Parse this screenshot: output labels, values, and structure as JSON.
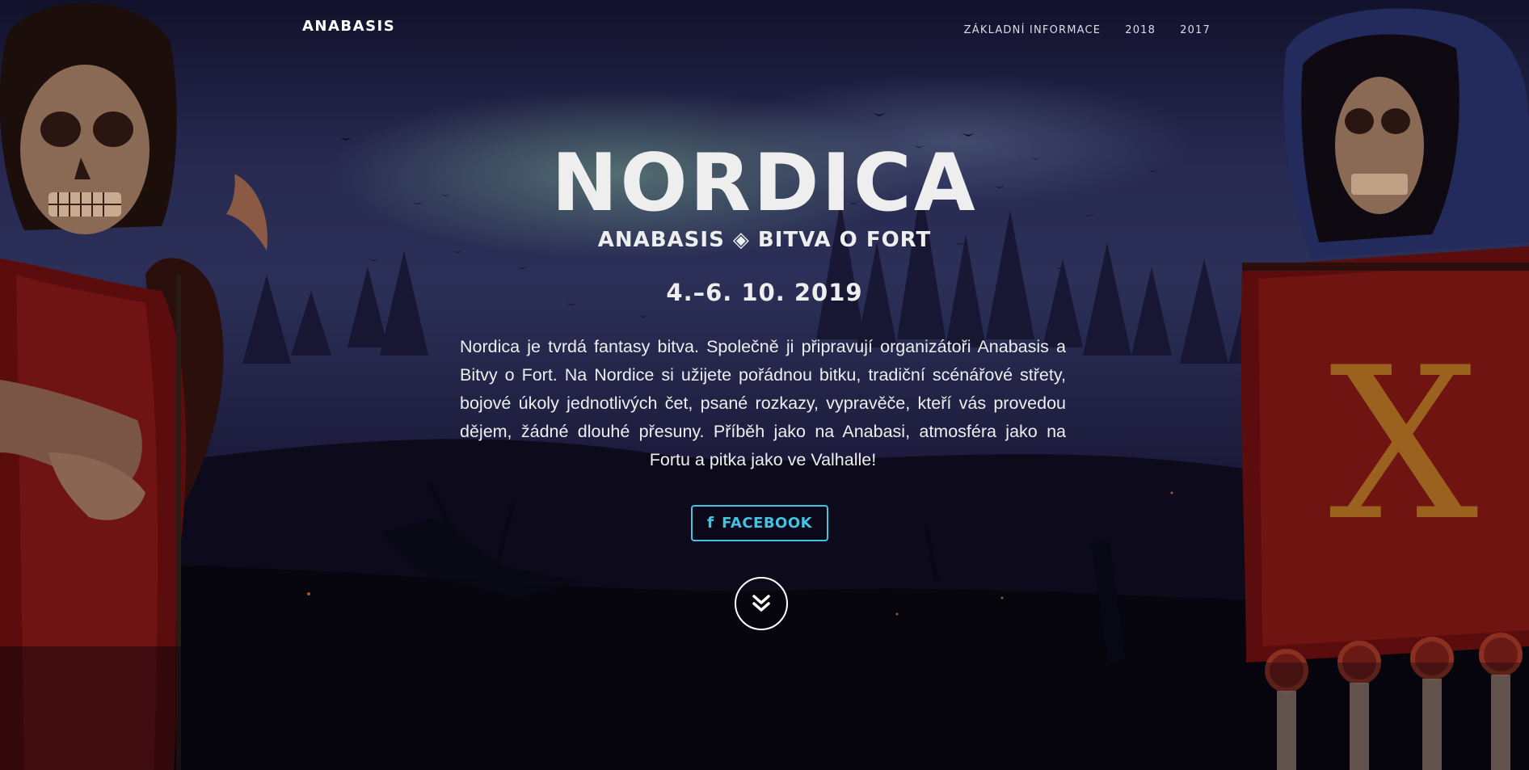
{
  "navbar": {
    "brand": "ANABASIS",
    "links": [
      {
        "label": "ZÁKLADNÍ INFORMACE"
      },
      {
        "label": "2018"
      },
      {
        "label": "2017"
      }
    ]
  },
  "hero": {
    "title": "NORDICA",
    "subtitle": "ANABASIS ◈ BITVA O FORT",
    "date": "4.–6. 10. 2019",
    "description": "Nordica je tvrdá fantasy bitva. Společně ji připravují organizátoři Anabasis a Bitvy o Fort. Na Nordice si užijete pořádnou bitku, tradiční scénářové střety, bojové úkoly jednotlivých čet, psané rozkazy, vypravěče, kteří vás provedou dějem, žádné dlouhé přesuny. Příběh jako na Anabasi, atmosféra jako na Fortu a pitka jako ve Valhalle!",
    "facebook_button": {
      "icon": "facebook-icon",
      "label": "FACEBOOK"
    },
    "scroll_icon": "double-chevron-down-icon"
  },
  "colors": {
    "accent": "#42c3e0",
    "text": "#eeeeee",
    "background_dark": "#06050f"
  }
}
